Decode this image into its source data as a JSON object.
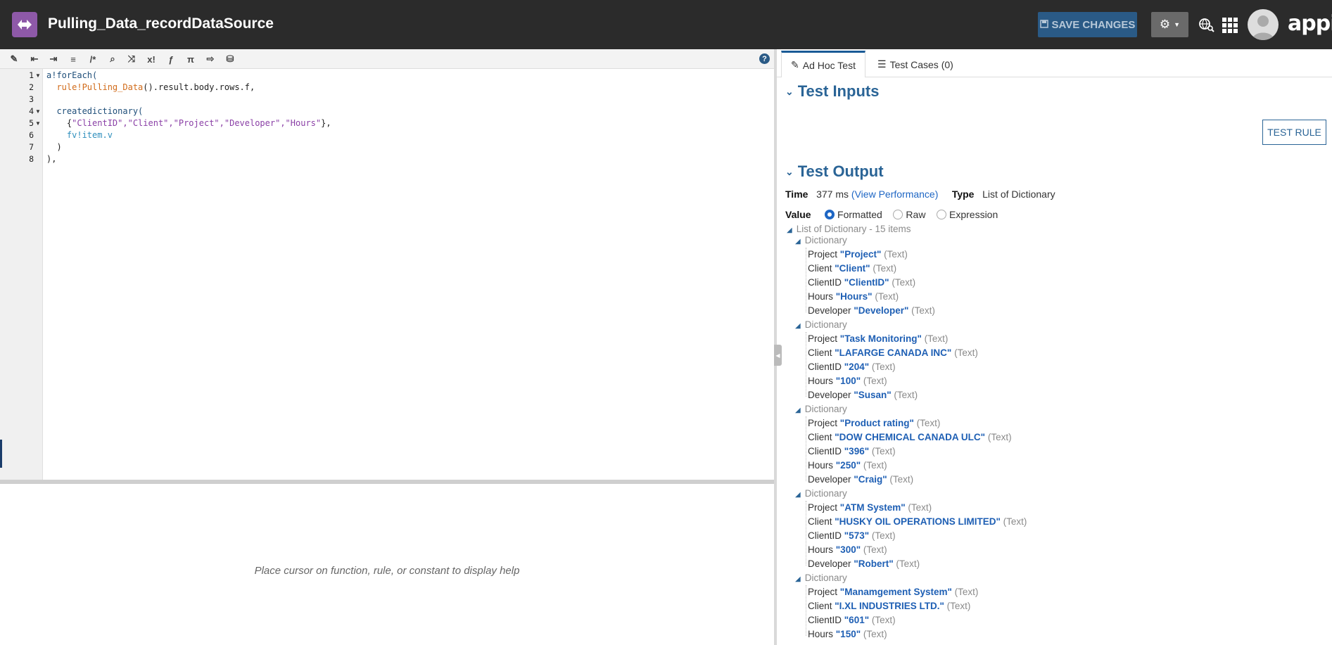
{
  "header": {
    "title": "Pulling_Data_recordDataSource",
    "save_label": "SAVE CHANGES",
    "brand": "appian"
  },
  "editor": {
    "line_numbers": [
      "1",
      "2",
      "3",
      "4",
      "5",
      "6",
      "7",
      "8"
    ],
    "help_placeholder": "Place cursor on function, rule, or constant to display help"
  },
  "tabs": {
    "adhoc": "Ad Hoc Test",
    "cases": "Test Cases (0)"
  },
  "test_inputs": {
    "title": "Test Inputs",
    "button": "TEST RULE"
  },
  "test_output": {
    "title": "Test Output",
    "time_label": "Time",
    "time_value": "377 ms",
    "perf_link": "(View Performance)",
    "type_label": "Type",
    "type_value": "List of Dictionary",
    "value_label": "Value",
    "options": [
      "Formatted",
      "Raw",
      "Expression"
    ],
    "root_label": "List of Dictionary - 15 items",
    "dict_label": "Dictionary",
    "type_suffix": "(Text)"
  },
  "results": [
    [
      [
        "Project",
        "\"Project\""
      ],
      [
        "Client",
        "\"Client\""
      ],
      [
        "ClientID",
        "\"ClientID\""
      ],
      [
        "Hours",
        "\"Hours\""
      ],
      [
        "Developer",
        "\"Developer\""
      ]
    ],
    [
      [
        "Project",
        "\"Task Monitoring\""
      ],
      [
        "Client",
        "\"LAFARGE CANADA INC\""
      ],
      [
        "ClientID",
        "\"204\""
      ],
      [
        "Hours",
        "\"100\""
      ],
      [
        "Developer",
        "\"Susan\""
      ]
    ],
    [
      [
        "Project",
        "\"Product rating\""
      ],
      [
        "Client",
        "\"DOW CHEMICAL CANADA ULC\""
      ],
      [
        "ClientID",
        "\"396\""
      ],
      [
        "Hours",
        "\"250\""
      ],
      [
        "Developer",
        "\"Craig\""
      ]
    ],
    [
      [
        "Project",
        "\"ATM System\""
      ],
      [
        "Client",
        "\"HUSKY OIL OPERATIONS LIMITED\""
      ],
      [
        "ClientID",
        "\"573\""
      ],
      [
        "Hours",
        "\"300\""
      ],
      [
        "Developer",
        "\"Robert\""
      ]
    ],
    [
      [
        "Project",
        "\"Manamgement System\""
      ],
      [
        "Client",
        "\"I.XL INDUSTRIES LTD.\""
      ],
      [
        "ClientID",
        "\"601\""
      ],
      [
        "Hours",
        "\"150\""
      ]
    ]
  ]
}
